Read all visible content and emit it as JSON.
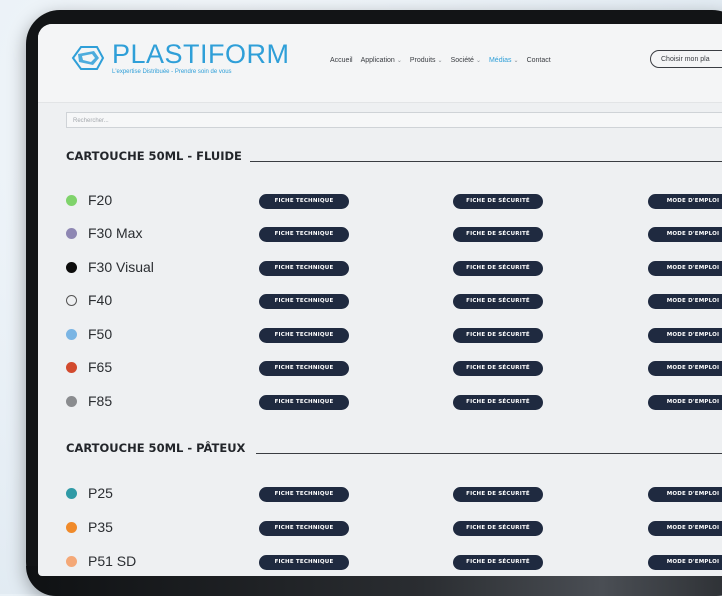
{
  "header": {
    "brand": "PLASTIFORM",
    "tagline": "L'expertise Distribuée - Prendre soin de vous",
    "nav": [
      {
        "label": "Accueil",
        "dropdown": false,
        "active": false
      },
      {
        "label": "Application",
        "dropdown": true,
        "active": false
      },
      {
        "label": "Produits",
        "dropdown": true,
        "active": false
      },
      {
        "label": "Société",
        "dropdown": true,
        "active": false
      },
      {
        "label": "Médias",
        "dropdown": true,
        "active": true
      },
      {
        "label": "Contact",
        "dropdown": false,
        "active": false
      }
    ],
    "cta": "Choisir mon pla"
  },
  "search": {
    "placeholder": "Rechercher..."
  },
  "buttons": {
    "tech": "FICHE TECHNIQUE",
    "safety": "FICHE DE SÉCURITÉ",
    "usage": "MODE D'EMPLOI"
  },
  "sections": [
    {
      "title": "CARTOUCHE 50ML - FLUIDE",
      "products": [
        {
          "name": "F20",
          "color": "#7fd36b"
        },
        {
          "name": "F30 Max",
          "color": "#8e87b3"
        },
        {
          "name": "F30 Visual",
          "color": "#0c0c0c"
        },
        {
          "name": "F40",
          "color": "#ffffff"
        },
        {
          "name": "F50",
          "color": "#7ab5e4"
        },
        {
          "name": "F65",
          "color": "#d24a2e"
        },
        {
          "name": "F85",
          "color": "#8a8c8f"
        }
      ]
    },
    {
      "title": "CARTOUCHE 50ML - PÂTEUX",
      "products": [
        {
          "name": "P25",
          "color": "#2f9aa6"
        },
        {
          "name": "P35",
          "color": "#f08a2a"
        },
        {
          "name": "P51 SD",
          "color": "#f4a877"
        }
      ]
    }
  ]
}
